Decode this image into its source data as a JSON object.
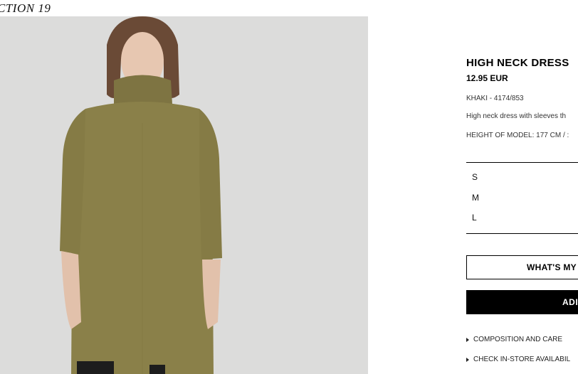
{
  "collection": {
    "title": "CTION 19"
  },
  "product": {
    "name": "HIGH NECK DRESS",
    "price": "12.95 EUR",
    "color_ref": "KHAKI - 4174/853",
    "description": "High neck dress with sleeves th",
    "model_height": "HEIGHT OF MODEL: 177 CM / :"
  },
  "sizes": [
    "S",
    "M",
    "L"
  ],
  "buttons": {
    "size_guide_label": "WHAT'S MY",
    "add_label": "ADI"
  },
  "links": {
    "composition_label": "COMPOSITION AND CARE",
    "store_label": "CHECK IN-STORE AVAILABIL"
  },
  "icons": {
    "composition": "caret-right-icon",
    "store": "caret-right-icon"
  },
  "colors": {
    "dress": "#8a8049",
    "background": "#dcdcdb",
    "button": "#000000"
  }
}
